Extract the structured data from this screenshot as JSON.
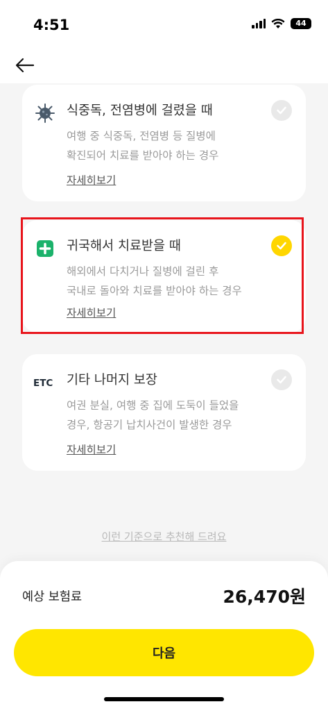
{
  "status_bar": {
    "time": "4:51",
    "battery": "44"
  },
  "cards": [
    {
      "icon": "virus-icon",
      "title": "식중독, 전염병에 걸렸을 때",
      "desc_line1": "여행 중 식중독, 전염병 등 질병에",
      "desc_line2": "확진되어 치료를 받아야 하는 경우",
      "link": "자세히보기",
      "checked": false
    },
    {
      "icon": "medical-plus-icon",
      "title": "귀국해서 치료받을 때",
      "desc_line1": "해외에서 다치거나 질병에 걸린 후",
      "desc_line2": "국내로 돌아와 치료를 받아야 하는 경우",
      "link": "자세히보기",
      "checked": true
    },
    {
      "icon": "ETC",
      "title": "기타 나머지 보장",
      "desc_line1": "여권 분실, 여행 중 집에 도둑이 들었을",
      "desc_line2": "경우, 항공기 납치사건이 발생한 경우",
      "link": "자세히보기",
      "checked": false
    }
  ],
  "recommend_link": "이런 기준으로 추천해 드려요",
  "bottom": {
    "premium_label": "예상 보험료",
    "premium_value": "26,470원",
    "next_button": "다음"
  },
  "colors": {
    "accent": "#ffe600",
    "check_on": "#ffd600",
    "highlight": "#e8141b",
    "medical_green": "#1bb26b"
  }
}
